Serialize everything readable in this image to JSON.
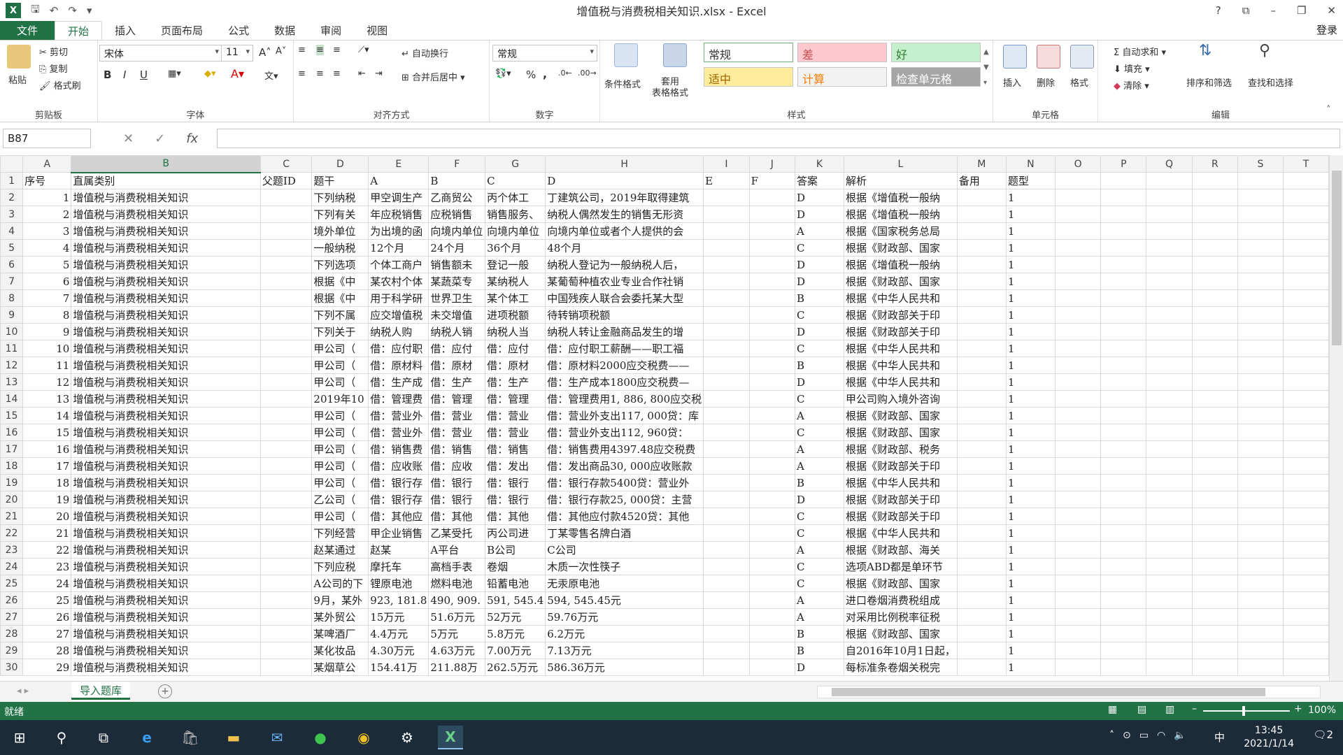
{
  "window": {
    "title": "增值税与消费税相关知识.xlsx - Excel",
    "controls": [
      "?",
      "⧉",
      "–",
      "❐",
      "✕"
    ],
    "login": "登录"
  },
  "tabs": [
    {
      "label": "文件",
      "kind": "file"
    },
    {
      "label": "开始",
      "kind": "active"
    },
    {
      "label": "插入"
    },
    {
      "label": "页面布局"
    },
    {
      "label": "公式"
    },
    {
      "label": "数据"
    },
    {
      "label": "审阅"
    },
    {
      "label": "视图"
    }
  ],
  "ribbon": {
    "clipboard": {
      "paste": "粘贴",
      "cut": "剪切",
      "copy": "复制",
      "format_painter": "格式刷",
      "label": "剪贴板"
    },
    "font": {
      "name": "宋体",
      "size": "11",
      "bold": "B",
      "italic": "I",
      "underline": "U",
      "label": "字体"
    },
    "alignment": {
      "wrap": "自动换行",
      "merge": "合并后居中",
      "label": "对齐方式"
    },
    "number": {
      "format": "常规",
      "percent": "%",
      "comma": ",",
      "label": "数字"
    },
    "styles": {
      "conditional": "条件格式",
      "table_format": "套用\n表格格式",
      "boxes": [
        {
          "text": "常规",
          "bg": "#ffffff",
          "fg": "#333333",
          "border": "#6fb07a"
        },
        {
          "text": "差",
          "bg": "#ffc7ce",
          "fg": "#c0504d"
        },
        {
          "text": "好",
          "bg": "#c6efce",
          "fg": "#2e7d32"
        },
        {
          "text": "适中",
          "bg": "#ffeb9c",
          "fg": "#9c6500"
        },
        {
          "text": "计算",
          "bg": "#f2f2f2",
          "fg": "#fa7d00"
        },
        {
          "text": "检查单元格",
          "bg": "#a5a5a5",
          "fg": "#ffffff"
        }
      ],
      "label": "样式"
    },
    "cells": {
      "insert": "插入",
      "delete": "删除",
      "format": "格式",
      "label": "单元格"
    },
    "editing": {
      "autosum": "自动求和",
      "fill": "填充",
      "clear": "清除",
      "sort": "排序和筛选",
      "find": "查找和选择",
      "label": "编辑"
    }
  },
  "formula_bar": {
    "namebox": "B87",
    "fx": "fx",
    "content": ""
  },
  "sheet": {
    "columns": [
      "A",
      "B",
      "C",
      "D",
      "E",
      "F",
      "G",
      "H",
      "I",
      "J",
      "K",
      "L",
      "M",
      "N",
      "O",
      "P",
      "Q",
      "R",
      "S",
      "T"
    ],
    "selected_column": "B",
    "header_row": [
      "序号",
      "直属类别",
      "父题ID",
      "题干",
      "A",
      "B",
      "C",
      "D",
      "E",
      "F",
      "答案",
      "解析",
      "备用",
      "题型"
    ],
    "rows": [
      [
        "1",
        "增值税与消费税相关知识",
        "",
        "下列纳税",
        "甲空调生产",
        "乙商贸公",
        "丙个体工",
        "丁建筑公司，2019年取得建筑",
        "",
        "",
        "D",
        "根据《增值税一般纳",
        "",
        "1"
      ],
      [
        "2",
        "增值税与消费税相关知识",
        "",
        "下列有关",
        "年应税销售",
        "应税销售",
        "销售服务、",
        "纳税人偶然发生的销售无形资",
        "",
        "",
        "D",
        "根据《增值税一般纳",
        "",
        "1"
      ],
      [
        "3",
        "增值税与消费税相关知识",
        "",
        "境外单位",
        "为出境的函",
        "向境内单位",
        "向境内单位",
        "向境内单位或者个人提供的会",
        "",
        "",
        "A",
        "根据《国家税务总局",
        "",
        "1"
      ],
      [
        "4",
        "增值税与消费税相关知识",
        "",
        "一般纳税",
        "12个月",
        "24个月",
        "36个月",
        "48个月",
        "",
        "",
        "C",
        "根据《财政部、国家",
        "",
        "1"
      ],
      [
        "5",
        "增值税与消费税相关知识",
        "",
        "下列选项",
        "个体工商户",
        "销售额未",
        "登记一般",
        "纳税人登记为一般纳税人后，",
        "",
        "",
        "D",
        "根据《增值税一般纳",
        "",
        "1"
      ],
      [
        "6",
        "增值税与消费税相关知识",
        "",
        "根据《中",
        "某农村个体",
        "某蔬菜专",
        "某纳税人",
        "某葡萄种植农业专业合作社销",
        "",
        "",
        "D",
        "根据《财政部、国家",
        "",
        "1"
      ],
      [
        "7",
        "增值税与消费税相关知识",
        "",
        "根据《中",
        "用于科学研",
        "世界卫生",
        "某个体工",
        "中国残疾人联合会委托某大型",
        "",
        "",
        "B",
        "根据《中华人民共和",
        "",
        "1"
      ],
      [
        "8",
        "增值税与消费税相关知识",
        "",
        "下列不属",
        "应交增值税",
        "未交增值",
        "进项税额",
        "待转销项税额",
        "",
        "",
        "C",
        "根据《财政部关于印",
        "",
        "1"
      ],
      [
        "9",
        "增值税与消费税相关知识",
        "",
        "下列关于",
        "纳税人购",
        "纳税人销",
        "纳税人当",
        "纳税人转让金融商品发生的增",
        "",
        "",
        "D",
        "根据《财政部关于印",
        "",
        "1"
      ],
      [
        "10",
        "增值税与消费税相关知识",
        "",
        "甲公司（",
        "借：应付职",
        "借：应付",
        "借：应付",
        "借：应付职工薪酬——职工福",
        "",
        "",
        "C",
        "根据《中华人民共和",
        "",
        "1"
      ],
      [
        "11",
        "增值税与消费税相关知识",
        "",
        "甲公司（",
        "借：原材料",
        "借：原材",
        "借：原材",
        "借：原材料2000应交税费——",
        "",
        "",
        "B",
        "根据《中华人民共和",
        "",
        "1"
      ],
      [
        "12",
        "增值税与消费税相关知识",
        "",
        "甲公司（",
        "借：生产成",
        "借：生产",
        "借：生产",
        "借：生产成本1800应交税费—",
        "",
        "",
        "D",
        "根据《中华人民共和",
        "",
        "1"
      ],
      [
        "13",
        "增值税与消费税相关知识",
        "",
        "2019年10",
        "借：管理费",
        "借：管理",
        "借：管理",
        "借：管理费用1, 886, 800应交税",
        "",
        "",
        "C",
        "甲公司购入境外咨询",
        "",
        "1"
      ],
      [
        "14",
        "增值税与消费税相关知识",
        "",
        "甲公司（",
        "借：营业外",
        "借：营业",
        "借：营业",
        "借：营业外支出117, 000贷：库",
        "",
        "",
        "A",
        "根据《财政部、国家",
        "",
        "1"
      ],
      [
        "15",
        "增值税与消费税相关知识",
        "",
        "甲公司（",
        "借：营业外",
        "借：营业",
        "借：营业",
        "借：营业外支出112, 960贷：",
        "",
        "",
        "C",
        "根据《财政部、国家",
        "",
        "1"
      ],
      [
        "16",
        "增值税与消费税相关知识",
        "",
        "甲公司（",
        "借：销售费",
        "借：销售",
        "借：销售",
        "借：销售费用4397.48应交税费",
        "",
        "",
        "A",
        "根据《财政部、税务",
        "",
        "1"
      ],
      [
        "17",
        "增值税与消费税相关知识",
        "",
        "甲公司（",
        "借：应收账",
        "借：应收",
        "借：发出",
        "借：发出商品30, 000应收账款",
        "",
        "",
        "A",
        "根据《财政部关于印",
        "",
        "1"
      ],
      [
        "18",
        "增值税与消费税相关知识",
        "",
        "甲公司（",
        "借：银行存",
        "借：银行",
        "借：银行",
        "借：银行存款5400贷：营业外",
        "",
        "",
        "B",
        "根据《中华人民共和",
        "",
        "1"
      ],
      [
        "19",
        "增值税与消费税相关知识",
        "",
        "乙公司（",
        "借：银行存",
        "借：银行",
        "借：银行",
        "借：银行存款25, 000贷：主营",
        "",
        "",
        "D",
        "根据《财政部关于印",
        "",
        "1"
      ],
      [
        "20",
        "增值税与消费税相关知识",
        "",
        "甲公司（",
        "借：其他应",
        "借：其他",
        "借：其他",
        "借：其他应付款4520贷：其他",
        "",
        "",
        "C",
        "根据《财政部关于印",
        "",
        "1"
      ],
      [
        "21",
        "增值税与消费税相关知识",
        "",
        "下列经营",
        "甲企业销售",
        "乙某受托",
        "丙公司进",
        "丁某零售名牌白酒",
        "",
        "",
        "C",
        "根据《中华人民共和",
        "",
        "1"
      ],
      [
        "22",
        "增值税与消费税相关知识",
        "",
        "赵某通过",
        "赵某",
        "A平台",
        "B公司",
        "C公司",
        "",
        "",
        "A",
        "根据《财政部、海关",
        "",
        "1"
      ],
      [
        "23",
        "增值税与消费税相关知识",
        "",
        "下列应税",
        "摩托车",
        "高档手表",
        "卷烟",
        "木质一次性筷子",
        "",
        "",
        "C",
        "选项ABD都是单环节",
        "",
        "1"
      ],
      [
        "24",
        "增值税与消费税相关知识",
        "",
        "A公司的下",
        "锂原电池",
        "燃料电池",
        "铅蓄电池",
        "无汞原电池",
        "",
        "",
        "C",
        "根据《财政部、国家",
        "",
        "1"
      ],
      [
        "25",
        "增值税与消费税相关知识",
        "",
        "9月，某外",
        "923, 181.8",
        "490, 909.",
        "591, 545.4",
        "594, 545.45元",
        "",
        "",
        "A",
        "进口卷烟消费税组成",
        "",
        "1"
      ],
      [
        "26",
        "增值税与消费税相关知识",
        "",
        "某外贸公",
        "15万元",
        "51.6万元",
        "52万元",
        "59.76万元",
        "",
        "",
        "A",
        "对采用比例税率征税",
        "",
        "1"
      ],
      [
        "27",
        "增值税与消费税相关知识",
        "",
        "某啤酒厂",
        "4.4万元",
        "5万元",
        "5.8万元",
        "6.2万元",
        "",
        "",
        "B",
        "根据《财政部、国家",
        "",
        "1"
      ],
      [
        "28",
        "增值税与消费税相关知识",
        "",
        "某化妆品",
        "4.30万元",
        "4.63万元",
        "7.00万元",
        "7.13万元",
        "",
        "",
        "B",
        "自2016年10月1日起，",
        "",
        "1"
      ],
      [
        "29",
        "增值税与消费税相关知识",
        "",
        "某烟草公",
        "154.41万",
        "211.88万",
        "262.5万元",
        "586.36万元",
        "",
        "",
        "D",
        "每标准条卷烟关税完",
        "",
        "1"
      ]
    ]
  },
  "sheet_tab": "导入题库",
  "status": {
    "ready": "就绪",
    "zoom": "100%"
  },
  "taskbar": {
    "time": "13:45",
    "date": "2021/1/14",
    "ime": "中",
    "notif": "2"
  }
}
